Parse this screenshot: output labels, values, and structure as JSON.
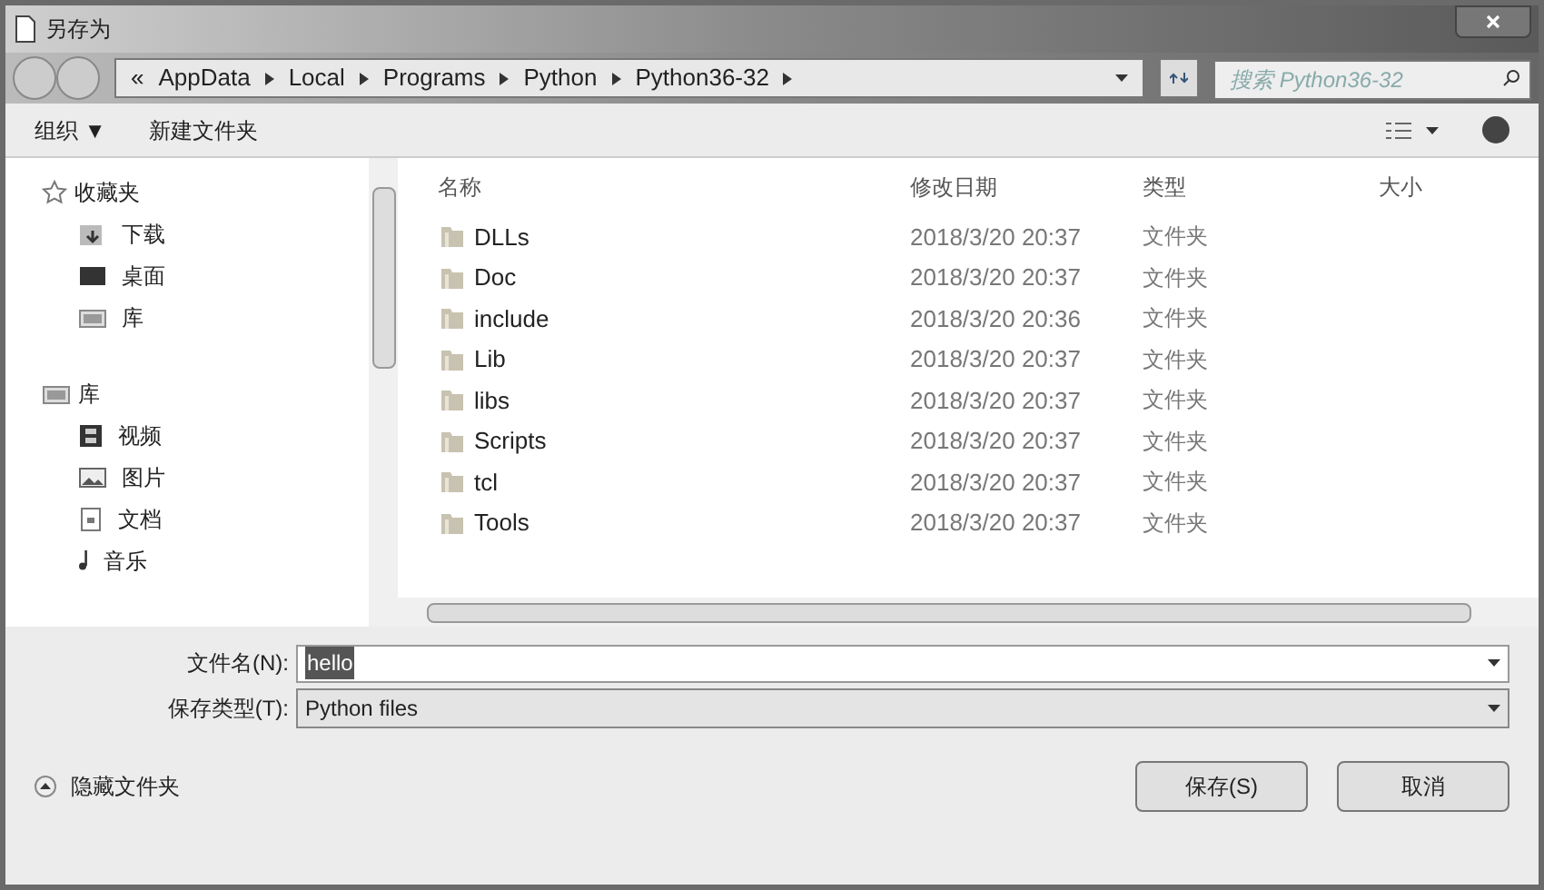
{
  "window": {
    "title": "另存为"
  },
  "address": {
    "overflow": "«",
    "segments": [
      "AppData",
      "Local",
      "Programs",
      "Python",
      "Python36-32"
    ]
  },
  "search": {
    "placeholder": "搜索 Python36-32"
  },
  "toolbar": {
    "organize": "组织 ▼",
    "new_folder": "新建文件夹"
  },
  "sidebar": {
    "groups": [
      {
        "label": "收藏夹",
        "kind": "favorites",
        "items": [
          {
            "label": "下载",
            "kind": "downloads"
          },
          {
            "label": "桌面",
            "kind": "desktop"
          },
          {
            "label": "库",
            "kind": "library"
          }
        ]
      },
      {
        "label": "库",
        "kind": "library",
        "items": [
          {
            "label": "视频",
            "kind": "videos"
          },
          {
            "label": "图片",
            "kind": "pictures"
          },
          {
            "label": "文档",
            "kind": "documents"
          },
          {
            "label": "音乐",
            "kind": "music"
          }
        ]
      }
    ]
  },
  "table": {
    "columns": [
      "名称",
      "修改日期",
      "类型",
      "大小"
    ],
    "rows": [
      {
        "name": "DLLs",
        "date": "2018/3/20 20:37",
        "type": "文件夹"
      },
      {
        "name": "Doc",
        "date": "2018/3/20 20:37",
        "type": "文件夹"
      },
      {
        "name": "include",
        "date": "2018/3/20 20:36",
        "type": "文件夹"
      },
      {
        "name": "Lib",
        "date": "2018/3/20 20:37",
        "type": "文件夹"
      },
      {
        "name": "libs",
        "date": "2018/3/20 20:37",
        "type": "文件夹"
      },
      {
        "name": "Scripts",
        "date": "2018/3/20 20:37",
        "type": "文件夹"
      },
      {
        "name": "tcl",
        "date": "2018/3/20 20:37",
        "type": "文件夹"
      },
      {
        "name": "Tools",
        "date": "2018/3/20 20:37",
        "type": "文件夹"
      }
    ]
  },
  "form": {
    "filename_label": "文件名(N):",
    "filename": "hello",
    "filename_selected": true,
    "type_label": "保存类型(T):",
    "type": "Python files"
  },
  "footer": {
    "hide_folders": "隐藏文件夹",
    "buttons": [
      "保存(S)",
      "取消"
    ]
  }
}
